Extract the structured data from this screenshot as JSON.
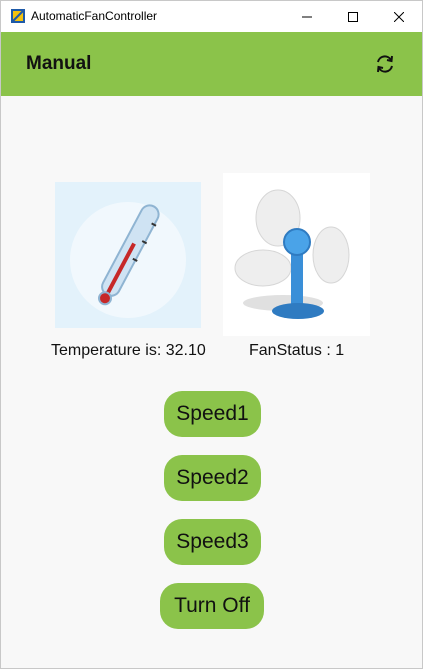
{
  "window": {
    "title": "AutomaticFanController"
  },
  "appbar": {
    "title": "Manual",
    "refresh_icon": "refresh-icon",
    "color": "#8bc34a"
  },
  "status": {
    "temperature_text": "Temperature is: 32.10",
    "fan_status_text": "FanStatus : 1"
  },
  "buttons": {
    "speed1": "Speed1",
    "speed2": "Speed2",
    "speed3": "Speed3",
    "turn_off": "Turn Off"
  }
}
